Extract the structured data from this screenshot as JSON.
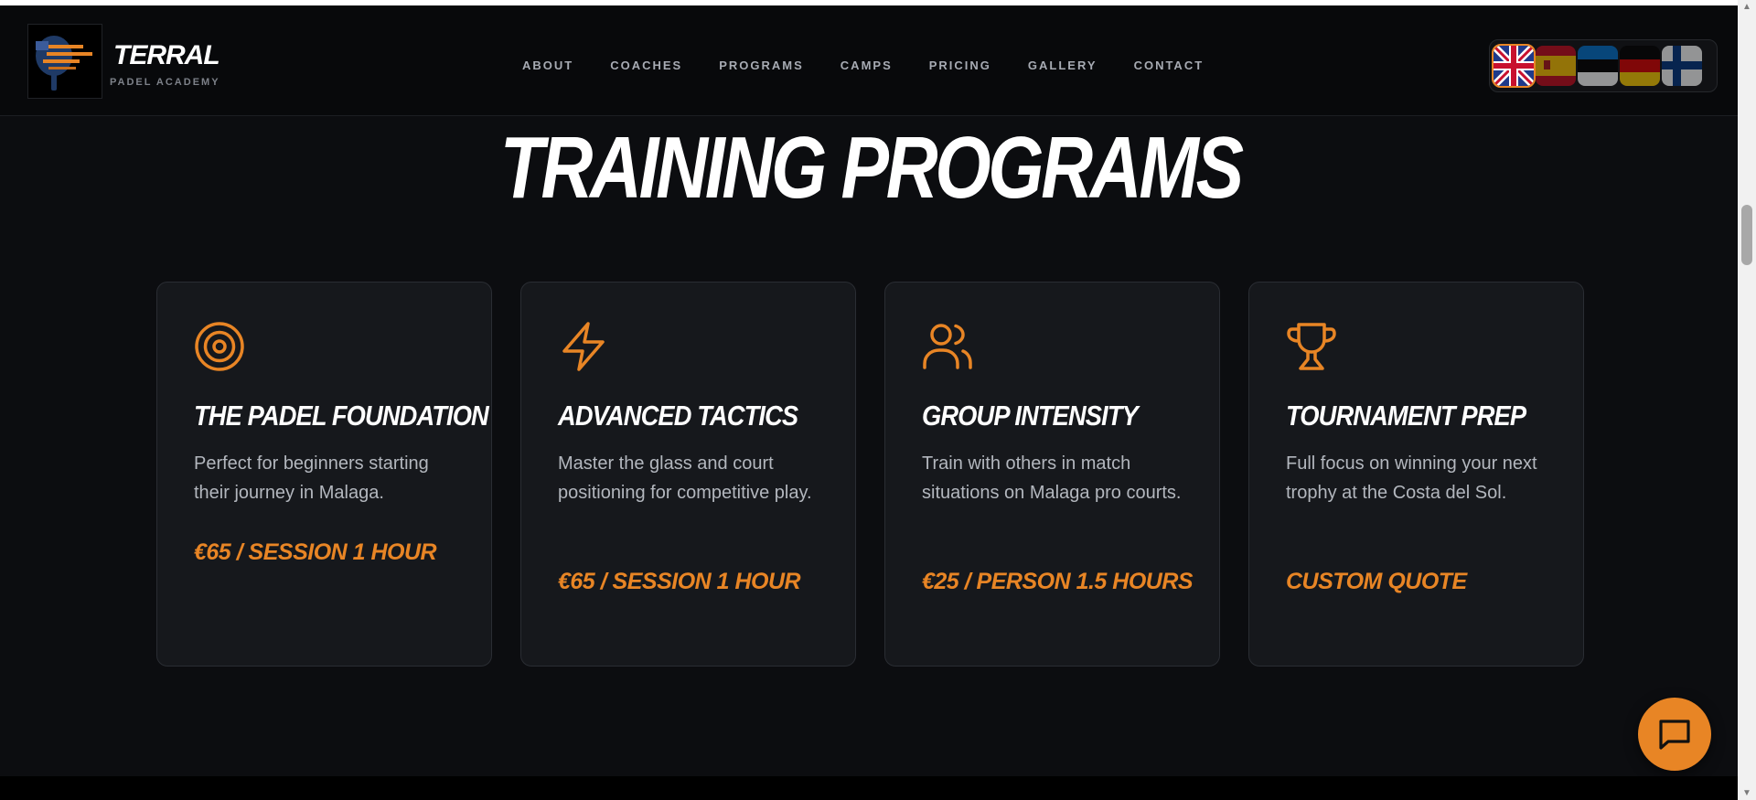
{
  "brand": {
    "name": "TERRAL",
    "subtitle": "PADEL ACADEMY"
  },
  "nav": {
    "items": [
      {
        "label": "ABOUT"
      },
      {
        "label": "COACHES"
      },
      {
        "label": "PROGRAMS"
      },
      {
        "label": "CAMPS"
      },
      {
        "label": "PRICING"
      },
      {
        "label": "GALLERY"
      },
      {
        "label": "CONTACT"
      }
    ]
  },
  "languages": [
    {
      "icon": "uk-flag-icon",
      "active": true
    },
    {
      "icon": "spain-flag-icon",
      "active": false
    },
    {
      "icon": "estonia-flag-icon",
      "active": false
    },
    {
      "icon": "germany-flag-icon",
      "active": false
    },
    {
      "icon": "finland-flag-icon",
      "active": false
    }
  ],
  "section": {
    "title": "TRAINING PROGRAMS"
  },
  "programs": [
    {
      "icon": "target-icon",
      "title": "THE PADEL FOUNDATION",
      "description": "Perfect for beginners starting their journey in Malaga.",
      "price": "€65 / SESSION 1 HOUR"
    },
    {
      "icon": "lightning-icon",
      "title": "ADVANCED TACTICS",
      "description": "Master the glass and court positioning for competitive play.",
      "price": "€65 / SESSION 1 HOUR"
    },
    {
      "icon": "users-icon",
      "title": "GROUP INTENSITY",
      "description": "Train with others in match situations on Malaga pro courts.",
      "price": "€25 / PERSON 1.5 HOURS"
    },
    {
      "icon": "trophy-icon",
      "title": "TOURNAMENT PREP",
      "description": "Full focus on winning your next trophy at the Costa del Sol.",
      "price": "CUSTOM QUOTE"
    }
  ],
  "chat": {
    "icon": "chat-bubble-icon"
  },
  "colors": {
    "accent": "#e88525",
    "background": "#0c0d10",
    "card": "#16181c"
  }
}
